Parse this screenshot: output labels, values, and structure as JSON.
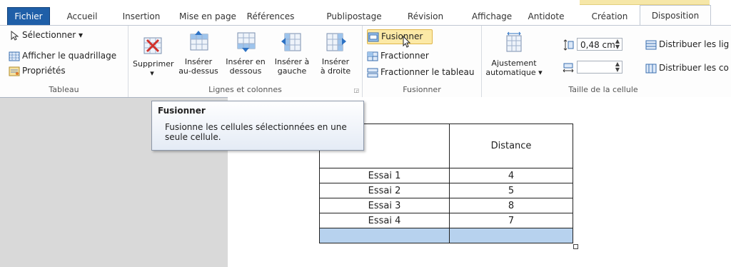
{
  "tabs": {
    "file": "Fichier",
    "home": "Accueil",
    "insert": "Insertion",
    "layout_page": "Mise en page",
    "references": "Références",
    "mailings": "Publipostage",
    "review": "Révision",
    "view": "Affichage",
    "antidote": "Antidote",
    "design": "Création",
    "layout": "Disposition"
  },
  "groups": {
    "table": {
      "label": "Tableau",
      "select": "Sélectionner ▾",
      "gridlines": "Afficher le quadrillage",
      "properties": "Propriétés"
    },
    "rows_cols": {
      "label": "Lignes et colonnes",
      "delete_line1": "Supprimer",
      "delete_line2": "▾",
      "insert_above_line1": "Insérer",
      "insert_above_line2": "au-dessus",
      "insert_below_line1": "Insérer en",
      "insert_below_line2": "dessous",
      "insert_left_line1": "Insérer à",
      "insert_left_line2": "gauche",
      "insert_right_line1": "Insérer",
      "insert_right_line2": "à droite"
    },
    "merge": {
      "label": "Fusionner",
      "merge": "Fusionner",
      "split": "Fractionner",
      "split_table": "Fractionner le tableau"
    },
    "autofit": {
      "line1": "Ajustement",
      "line2": "automatique ▾"
    },
    "cell_size": {
      "label": "Taille de la cellule",
      "height_value": "0,48 cm",
      "width_value": "",
      "dist_rows": "Distribuer les lig",
      "dist_cols": "Distribuer les co"
    }
  },
  "tooltip": {
    "title": "Fusionner",
    "body_line1": "Fusionne les cellules sélectionnées en une",
    "body_line2": "seule cellule."
  },
  "table": {
    "header": [
      "",
      "Distance"
    ],
    "rows": [
      [
        "Essai 1",
        "4"
      ],
      [
        "Essai 2",
        "5"
      ],
      [
        "Essai 3",
        "8"
      ],
      [
        "Essai 4",
        "7"
      ],
      [
        "",
        ""
      ]
    ]
  },
  "colors": {
    "file_tab": "#1f5fa8",
    "highlight": "#fce9a6",
    "selection": "#b7d2ee"
  }
}
